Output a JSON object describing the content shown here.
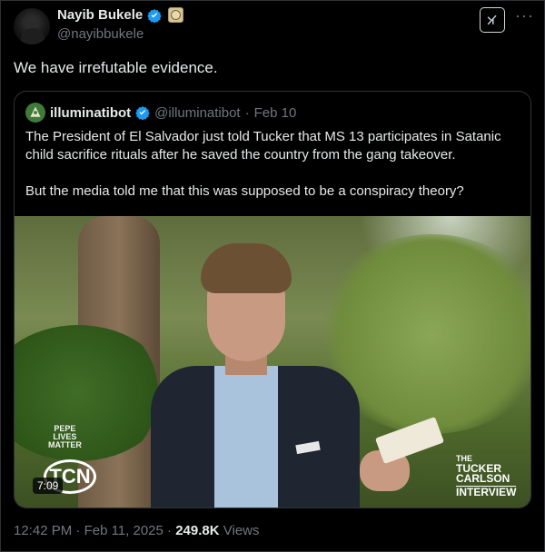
{
  "author": {
    "name": "Nayib Bukele",
    "handle": "@nayibbukele"
  },
  "tweet": {
    "text": "We have irrefutable evidence."
  },
  "quote": {
    "name": "illuminatibot",
    "handle": "@illuminatibot",
    "separator": "·",
    "date": "Feb 10",
    "paragraph1": "The President of El Salvador just told Tucker that MS 13 participates in Satanic child sacrifice rituals after he saved the country from the gang takeover.",
    "paragraph2": "But the media told me that this was supposed to be a conspiracy theory?",
    "video": {
      "duration": "7:09",
      "overlay_small": [
        "PEPE",
        "LIVES",
        "MATTER"
      ],
      "overlay_logo": "TCN",
      "brand": [
        "THE",
        "TUCKER",
        "CARLSON",
        "INTERVIEW"
      ]
    }
  },
  "footer": {
    "time": "12:42 PM",
    "dot": "·",
    "date": "Feb 11, 2025",
    "views_count": "249.8K",
    "views_label": "Views"
  },
  "icons": {
    "verified": "verified-badge-icon",
    "affiliate": "government-affiliate-icon",
    "grok": "grok-icon",
    "more": "more-options-icon"
  },
  "colors": {
    "background": "#000000",
    "text": "#e7e9ea",
    "muted": "#71767b",
    "verified": "#1d9bf0",
    "border": "#2f3336"
  }
}
